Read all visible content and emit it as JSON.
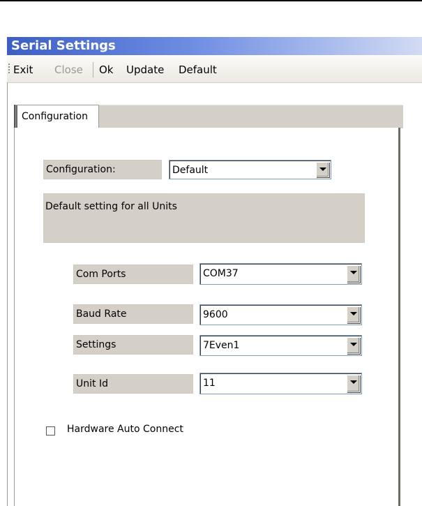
{
  "window": {
    "title": "Serial Settings"
  },
  "toolbar": {
    "exit": "Exit",
    "close": "Close",
    "ok": "Ok",
    "update": "Update",
    "default": "Default"
  },
  "tabs": [
    {
      "label": "Configuration"
    }
  ],
  "form": {
    "configuration": {
      "label": "Configuration:",
      "value": "Default"
    },
    "description": "Default setting for all Units",
    "com_ports": {
      "label": "Com Ports",
      "value": "COM37"
    },
    "baud_rate": {
      "label": "Baud Rate",
      "value": "9600"
    },
    "settings": {
      "label": "Settings",
      "value": "7Even1"
    },
    "unit_id": {
      "label": "Unit Id",
      "value": "11"
    },
    "hardware_auto_connect": {
      "label": "Hardware Auto Connect",
      "checked": false
    }
  },
  "colors": {
    "titlebar_start": "#3c5fc6",
    "titlebar_end": "#d2dbf3",
    "control_face": "#d4d0c8"
  }
}
